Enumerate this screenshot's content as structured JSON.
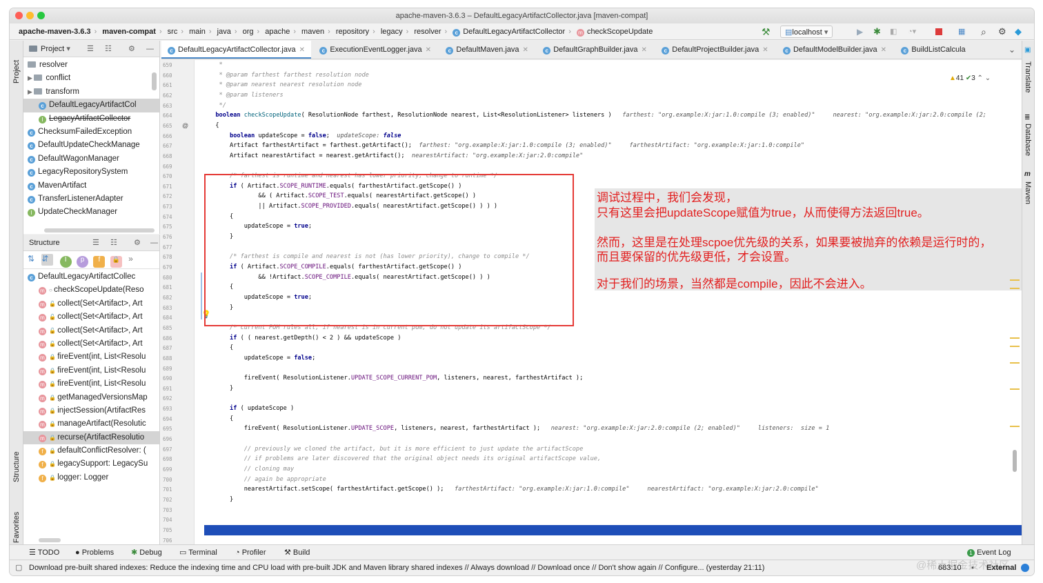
{
  "window": {
    "title": "apache-maven-3.6.3 – DefaultLegacyArtifactCollector.java [maven-compat]"
  },
  "navbar": {
    "crumbs": [
      "apache-maven-3.6.3",
      "maven-compat",
      "src",
      "main",
      "java",
      "org",
      "apache",
      "maven",
      "repository",
      "legacy",
      "resolver",
      "DefaultLegacyArtifactCollector",
      "checkScopeUpdate"
    ],
    "run_config": "localhost"
  },
  "tabs": [
    {
      "label": "DefaultLegacyArtifactCollector.java"
    },
    {
      "label": "ExecutionEventLogger.java"
    },
    {
      "label": "DefaultMaven.java"
    },
    {
      "label": "DefaultGraphBuilder.java"
    },
    {
      "label": "DefaultProjectBuilder.java"
    },
    {
      "label": "DefaultModelBuilder.java"
    },
    {
      "label": "BuildListCalcula"
    }
  ],
  "project": {
    "header": "Project",
    "strip_label": "Project",
    "items": [
      "resolver",
      "conflict",
      "transform",
      "DefaultLegacyArtifactCol",
      "LegacyArtifactCollector",
      "ChecksumFailedException",
      "DefaultUpdateCheckManage",
      "DefaultWagonManager",
      "LegacyRepositorySystem",
      "MavenArtifact",
      "TransferListenerAdapter",
      "UpdateCheckManager"
    ]
  },
  "structure": {
    "header": "Structure",
    "strip_label": "Structure",
    "favorites_label": "Favorites",
    "root": "DefaultLegacyArtifactCollec",
    "items": [
      "checkScopeUpdate(Reso",
      "collect(Set<Artifact>, Art",
      "collect(Set<Artifact>, Art",
      "collect(Set<Artifact>, Art",
      "collect(Set<Artifact>, Art",
      "fireEvent(int, List<Resolu",
      "fireEvent(int, List<Resolu",
      "fireEvent(int, List<Resolu",
      "getManagedVersionsMap",
      "injectSession(ArtifactRes",
      "manageArtifact(Resolutic",
      "recurse(ArtifactResolutio",
      "defaultConflictResolver: (",
      "legacySupport: LegacySu",
      "logger: Logger"
    ]
  },
  "editor": {
    "inspections": {
      "warnings": "41",
      "checks": "3"
    },
    "lines": [
      {
        "n": "659",
        "t": "   *"
      },
      {
        "n": "660",
        "t": "   * @param farthest farthest resolution node"
      },
      {
        "n": "661",
        "t": "   * @param nearest nearest resolution node"
      },
      {
        "n": "662",
        "t": "   * @param listeners"
      },
      {
        "n": "663",
        "t": "   */"
      },
      {
        "n": "664",
        "t": "  boolean checkScopeUpdate( ResolutionNode farthest, ResolutionNode nearest, List<ResolutionListener> listeners )   farthest: \"org.example:X:jar:1.0:compile (3; enabled)\"     nearest: \"org.example:X:jar:2.0:compile (2;"
      },
      {
        "n": "665",
        "t": "  {"
      },
      {
        "n": "666",
        "t": "      boolean updateScope = false;  updateScope: false"
      },
      {
        "n": "667",
        "t": "      Artifact farthestArtifact = farthest.getArtifact();  farthest: \"org.example:X:jar:1.0:compile (3; enabled)\"     farthestArtifact: \"org.example:X:jar:1.0:compile\""
      },
      {
        "n": "668",
        "t": "      Artifact nearestArtifact = nearest.getArtifact();  nearestArtifact: \"org.example:X:jar:2.0:compile\""
      },
      {
        "n": "669",
        "t": ""
      },
      {
        "n": "670",
        "t": "      /* farthest is runtime and nearest has lower priority, change to runtime */"
      },
      {
        "n": "671",
        "t": "      if ( Artifact.SCOPE_RUNTIME.equals( farthestArtifact.getScope() )"
      },
      {
        "n": "672",
        "t": "              && ( Artifact.SCOPE_TEST.equals( nearestArtifact.getScope() )"
      },
      {
        "n": "673",
        "t": "              || Artifact.SCOPE_PROVIDED.equals( nearestArtifact.getScope() ) ) )"
      },
      {
        "n": "674",
        "t": "      {"
      },
      {
        "n": "675",
        "t": "          updateScope = true;"
      },
      {
        "n": "676",
        "t": "      }"
      },
      {
        "n": "677",
        "t": ""
      },
      {
        "n": "678",
        "t": "      /* farthest is compile and nearest is not (has lower priority), change to compile */"
      },
      {
        "n": "679",
        "t": "      if ( Artifact.SCOPE_COMPILE.equals( farthestArtifact.getScope() )"
      },
      {
        "n": "680",
        "t": "              && !Artifact.SCOPE_COMPILE.equals( nearestArtifact.getScope() ) )"
      },
      {
        "n": "681",
        "t": "      {"
      },
      {
        "n": "682",
        "t": "          updateScope = true;"
      },
      {
        "n": "683",
        "t": "      }"
      },
      {
        "n": "684",
        "t": ""
      },
      {
        "n": "685",
        "t": "      /* current POM rules all, if nearest is in current pom, do not update its artifactScope */"
      },
      {
        "n": "686",
        "t": "      if ( ( nearest.getDepth() < 2 ) && updateScope )"
      },
      {
        "n": "687",
        "t": "      {"
      },
      {
        "n": "688",
        "t": "          updateScope = false;"
      },
      {
        "n": "689",
        "t": ""
      },
      {
        "n": "690",
        "t": "          fireEvent( ResolutionListener.UPDATE_SCOPE_CURRENT_POM, listeners, nearest, farthestArtifact );"
      },
      {
        "n": "691",
        "t": "      }"
      },
      {
        "n": "692",
        "t": ""
      },
      {
        "n": "693",
        "t": "      if ( updateScope )"
      },
      {
        "n": "694",
        "t": "      {"
      },
      {
        "n": "695",
        "t": "          fireEvent( ResolutionListener.UPDATE_SCOPE, listeners, nearest, farthestArtifact );   nearest: \"org.example:X:jar:2.0:compile (2; enabled)\"     listeners:  size = 1"
      },
      {
        "n": "696",
        "t": ""
      },
      {
        "n": "697",
        "t": "          // previously we cloned the artifact, but it is more efficient to just update the artifactScope"
      },
      {
        "n": "698",
        "t": "          // if problems are later discovered that the original object needs its original artifactScope value,"
      },
      {
        "n": "699",
        "t": "          // cloning may"
      },
      {
        "n": "700",
        "t": "          // again be appropriate"
      },
      {
        "n": "701",
        "t": "          nearestArtifact.setScope( farthestArtifact.getScope() );   farthestArtifact: \"org.example:X:jar:1.0:compile\"     nearestArtifact: \"org.example:X:jar:2.0:compile\""
      },
      {
        "n": "702",
        "t": "      }"
      },
      {
        "n": "703",
        "t": ""
      },
      {
        "n": "704",
        "t": "      return updateScope;  updateScope: false"
      },
      {
        "n": "705",
        "t": "  }"
      },
      {
        "n": "706",
        "t": ""
      }
    ]
  },
  "annotation": {
    "line1": "调试过程中，我们会发现，",
    "line2": "只有这里会把updateScope赋值为true，从而使得方法返回true。",
    "line3": "然而，这里是在处理scpoe优先级的关系，如果要被抛弃的依赖是运行时的，",
    "line4": "而且要保留的优先级更低，才会设置。",
    "line5": "对于我们的场景，当然都是compile，因此不会进入。"
  },
  "right_strip": [
    "Translate",
    "Database",
    "Maven"
  ],
  "bottom_tools": [
    "TODO",
    "Problems",
    "Debug",
    "Terminal",
    "Profiler",
    "Build",
    "Event Log"
  ],
  "status": {
    "message": "Download pre-built shared indexes: Reduce the indexing time and CPU load with pre-built JDK and Maven library shared indexes // Always download // Download once // Don't show again // Configure... (yesterday 21:11)",
    "position": "683:10",
    "badge": "External",
    "event_count": "1",
    "watermark": "@稀土掘金技术社区"
  },
  "colors": {
    "accent": "#4a88c7",
    "annotation_red": "#e21f1f",
    "exec_line": "#1e4eb8",
    "red_box": "#e53935"
  }
}
